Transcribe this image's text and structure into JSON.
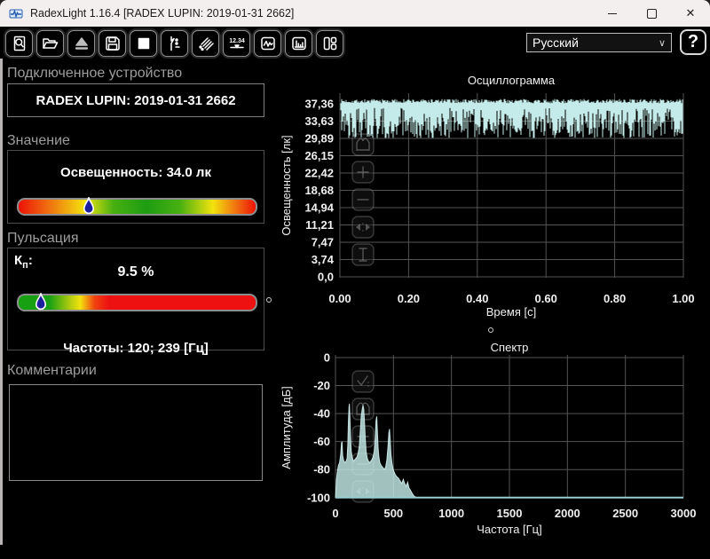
{
  "window": {
    "title": "RadexLight 1.16.4 [RADEX LUPIN: 2019-01-31 2662]",
    "controls": {
      "close_glyph": "✕"
    }
  },
  "toolbar": {
    "language": "Русский",
    "language_chevron": "∨",
    "help": "?",
    "icons": [
      "preview-icon",
      "open-folder-icon",
      "eject-icon",
      "save-icon",
      "stop-icon",
      "waveform-markers-icon",
      "sweep-icon",
      "digital-display-icon",
      "oscillogram-icon",
      "spectrum-icon",
      "layout-icon"
    ]
  },
  "device_panel": {
    "header": "Подключенное устройство",
    "device": "RADEX LUPIN: 2019-01-31 2662"
  },
  "value_panel": {
    "header": "Значение",
    "reading": "Освещенность: 34.0 лк",
    "marker_percent": 29.7,
    "marker_color": "#1b1f9e"
  },
  "pulsation_panel": {
    "header": "Пульсация",
    "kp_label": "К",
    "kp_sub": "п",
    "kp_colon": ":",
    "value": "9.5 %",
    "frequencies": "Частоты: 120; 239 [Гц]",
    "marker_percent": 9.3,
    "marker_color": "#1b1f9e"
  },
  "comments_panel": {
    "header": "Комментарии",
    "text": ""
  },
  "colors": {
    "wave": "#c4ebe9",
    "wave_fill": "rgba(196,235,233,0.82)",
    "baseline": "#96ced2",
    "grid": "#545454",
    "axis_text": "#f0f0f0"
  },
  "chart_data": [
    {
      "type": "line",
      "id": "oscillogram",
      "title": "Осциллограмма",
      "xlabel": "Время [с]",
      "ylabel": "Освещенность [лк]",
      "xlim": [
        0,
        1
      ],
      "ylim": [
        0,
        39.5
      ],
      "xticks": [
        "0.00",
        "0.20",
        "0.40",
        "0.60",
        "0.80",
        "1.00"
      ],
      "yticks": [
        "0,0",
        "3,74",
        "7,47",
        "11,21",
        "14,94",
        "18,68",
        "22,42",
        "26,15",
        "29,89",
        "33,63",
        "37,36"
      ],
      "ytick_values": [
        0,
        3.74,
        7.47,
        11.21,
        14.94,
        18.68,
        22.42,
        26.15,
        29.89,
        33.63,
        37.36
      ],
      "grid": true,
      "signal": {
        "description": "dense 120/239 Hz flicker waveform",
        "top": 37.4,
        "dip_min": 30.0,
        "mean": 34.0,
        "seed": 7
      }
    },
    {
      "type": "area",
      "id": "spectrum",
      "title": "Спектр",
      "xlabel": "Частота [Гц]",
      "ylabel": "Амплитуда [дБ]",
      "xlim": [
        0,
        3000
      ],
      "ylim": [
        -100,
        0
      ],
      "xticks": [
        0,
        500,
        1000,
        1500,
        2000,
        2500,
        3000
      ],
      "yticks": [
        0,
        -20,
        -40,
        -60,
        -80,
        -100
      ],
      "grid": true,
      "points": [
        [
          0,
          -100
        ],
        [
          8,
          -88
        ],
        [
          15,
          -82
        ],
        [
          25,
          -77
        ],
        [
          35,
          -75
        ],
        [
          45,
          -69
        ],
        [
          52,
          -61
        ],
        [
          57,
          -60
        ],
        [
          62,
          -70
        ],
        [
          72,
          -74
        ],
        [
          82,
          -75
        ],
        [
          92,
          -74
        ],
        [
          100,
          -72
        ],
        [
          106,
          -62
        ],
        [
          112,
          -45
        ],
        [
          117,
          -35
        ],
        [
          120,
          -33
        ],
        [
          124,
          -41
        ],
        [
          129,
          -55
        ],
        [
          136,
          -67
        ],
        [
          146,
          -72
        ],
        [
          156,
          -74
        ],
        [
          166,
          -73
        ],
        [
          176,
          -72
        ],
        [
          186,
          -71
        ],
        [
          196,
          -68
        ],
        [
          206,
          -63
        ],
        [
          214,
          -52
        ],
        [
          222,
          -42
        ],
        [
          230,
          -37
        ],
        [
          237,
          -34
        ],
        [
          244,
          -37
        ],
        [
          250,
          -46
        ],
        [
          257,
          -58
        ],
        [
          264,
          -67
        ],
        [
          274,
          -72
        ],
        [
          284,
          -74
        ],
        [
          294,
          -75
        ],
        [
          304,
          -74
        ],
        [
          314,
          -73
        ],
        [
          324,
          -71
        ],
        [
          334,
          -67
        ],
        [
          342,
          -58
        ],
        [
          350,
          -45
        ],
        [
          356,
          -42
        ],
        [
          361,
          -52
        ],
        [
          367,
          -64
        ],
        [
          374,
          -71
        ],
        [
          383,
          -75
        ],
        [
          393,
          -77
        ],
        [
          403,
          -78
        ],
        [
          413,
          -79
        ],
        [
          423,
          -80
        ],
        [
          433,
          -78
        ],
        [
          443,
          -73
        ],
        [
          452,
          -64
        ],
        [
          460,
          -54
        ],
        [
          466,
          -51
        ],
        [
          472,
          -59
        ],
        [
          478,
          -69
        ],
        [
          488,
          -76
        ],
        [
          498,
          -80
        ],
        [
          512,
          -83
        ],
        [
          527,
          -85
        ],
        [
          542,
          -86
        ],
        [
          557,
          -88
        ],
        [
          572,
          -90
        ],
        [
          585,
          -87
        ],
        [
          597,
          -90
        ],
        [
          610,
          -92
        ],
        [
          622,
          -89
        ],
        [
          634,
          -93
        ],
        [
          648,
          -95
        ],
        [
          662,
          -97
        ],
        [
          678,
          -99
        ],
        [
          700,
          -100
        ],
        [
          1000,
          -100
        ],
        [
          1500,
          -100
        ],
        [
          2000,
          -100
        ],
        [
          2500,
          -100
        ],
        [
          3000,
          -100
        ]
      ]
    }
  ]
}
